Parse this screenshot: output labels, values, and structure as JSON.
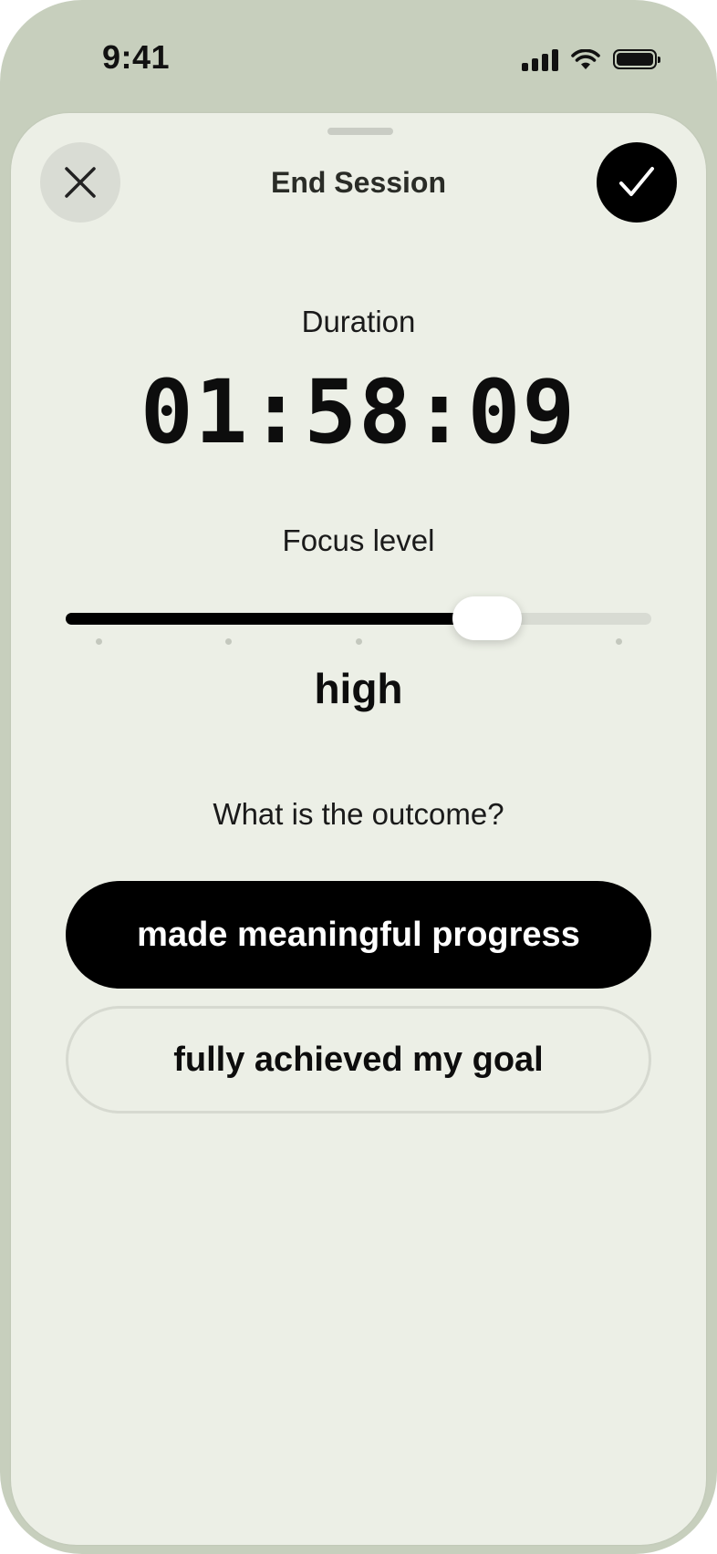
{
  "status_bar": {
    "time": "9:41",
    "icons": [
      "cellular-signal-icon",
      "wifi-icon",
      "battery-icon"
    ]
  },
  "sheet": {
    "title": "End Session",
    "close_icon": "close-icon",
    "confirm_icon": "checkmark-icon"
  },
  "duration": {
    "label": "Duration",
    "value": "01:58:09"
  },
  "focus": {
    "label": "Focus level",
    "value_text": "high",
    "slider_fraction": 0.72,
    "tick_count": 5
  },
  "outcome": {
    "question": "What is the outcome?",
    "options": [
      {
        "label": "made meaningful progress",
        "selected": true
      },
      {
        "label": "fully achieved my goal",
        "selected": false
      }
    ]
  },
  "colors": {
    "background": "#c7cfbd",
    "sheet": "#ecefe6",
    "accent": "#000000"
  }
}
